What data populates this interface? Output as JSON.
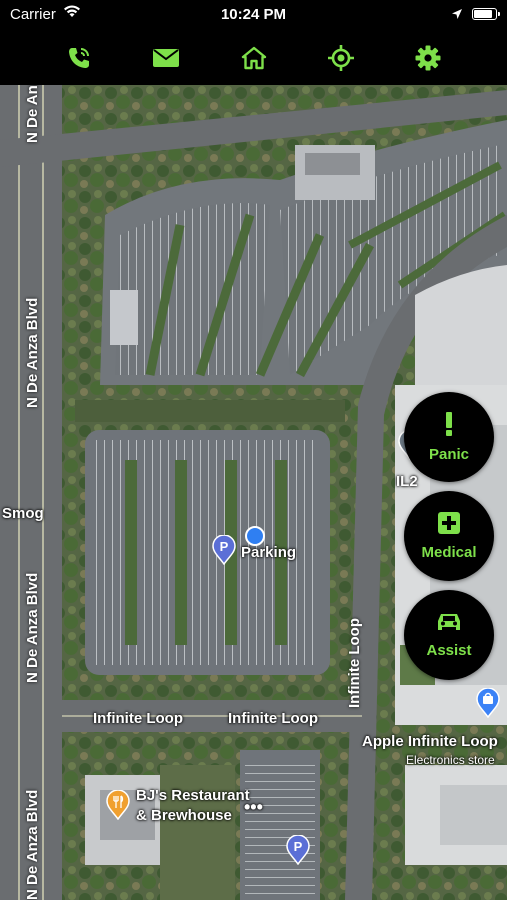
{
  "status_bar": {
    "carrier": "Carrier",
    "time": "10:24 PM",
    "battery_level": 0.9
  },
  "toolbar": {
    "icons": [
      "phone-icon",
      "mail-icon",
      "home-icon",
      "locate-icon",
      "settings-icon"
    ],
    "accent_color": "#7ee04a"
  },
  "map": {
    "labels": {
      "n_de_anza_top": "N De Anza",
      "n_de_anza_mid": "N De Anza Blvd",
      "n_de_anza_low": "N De Anza Blvd",
      "n_de_anza_bottom": "N De Anza Blvd",
      "smog": "Smog",
      "parking": "Parking",
      "il2": "IL2",
      "infinite_loop_left": "Infinite Loop",
      "infinite_loop_right": "Infinite Loop",
      "infinite_loop_vertical": "Infinite Loop",
      "apple_infinite_loop": "Apple Infinite Loop",
      "electronics_store": "Electronics store",
      "bjs_line1": "BJ's Restaurant",
      "bjs_line2": "& Brewhouse"
    }
  },
  "actions": {
    "panic": {
      "label": "Panic",
      "icon": "exclamation-icon"
    },
    "medical": {
      "label": "Medical",
      "icon": "medical-cross-icon"
    },
    "assist": {
      "label": "Assist",
      "icon": "car-icon"
    }
  }
}
